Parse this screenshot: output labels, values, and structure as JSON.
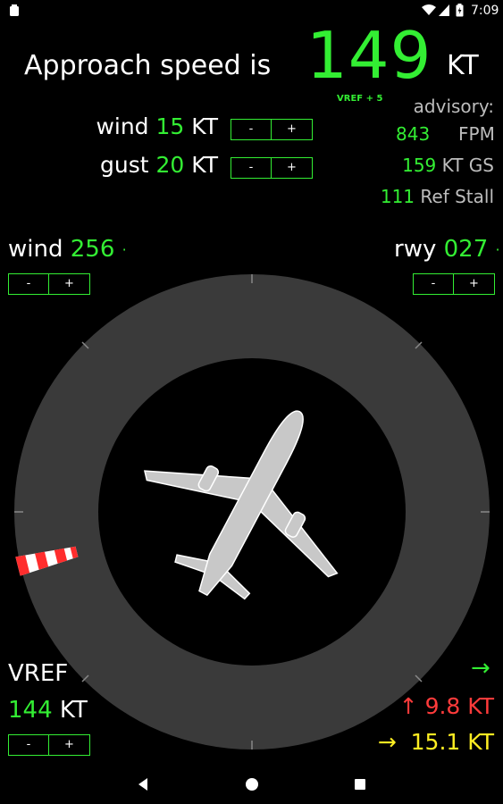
{
  "statusbar": {
    "time": "7:09"
  },
  "header": {
    "title": "Approach speed is",
    "speed": "149",
    "unit": "KT",
    "vref_note": "VREF + 5"
  },
  "wind_speed": {
    "label": "wind",
    "value": "15",
    "unit": "KT",
    "minus": "-",
    "plus": "+"
  },
  "gust": {
    "label": "gust",
    "value": "20",
    "unit": "KT",
    "minus": "-",
    "plus": "+"
  },
  "advisory": {
    "label": "advisory:",
    "fpm_value": "843",
    "fpm_unit": "FPM",
    "gs_value": "159",
    "gs_unit": "KT GS",
    "stall_value": "111",
    "stall_unit": "Ref Stall"
  },
  "wind_dir": {
    "label": "wind",
    "value": "256",
    "suffix": "·",
    "minus": "-",
    "plus": "+"
  },
  "runway": {
    "label": "rwy",
    "value": "027",
    "suffix": "·",
    "minus": "-",
    "plus": "+"
  },
  "vref": {
    "label": "VREF",
    "value": "144",
    "unit": "KT",
    "minus": "-",
    "plus": "+"
  },
  "components": {
    "arrow_right": "→",
    "headwind": "↑ 9.8 KT",
    "crosswind": "→  15.1 KT"
  },
  "colors": {
    "accent": "#33ee33",
    "dial": "#3a3a3a",
    "headwind": "#ff3b3b",
    "crosswind": "#ffee22"
  },
  "navbar": {
    "back": "back-icon",
    "home": "home-icon",
    "recents": "recents-icon"
  }
}
